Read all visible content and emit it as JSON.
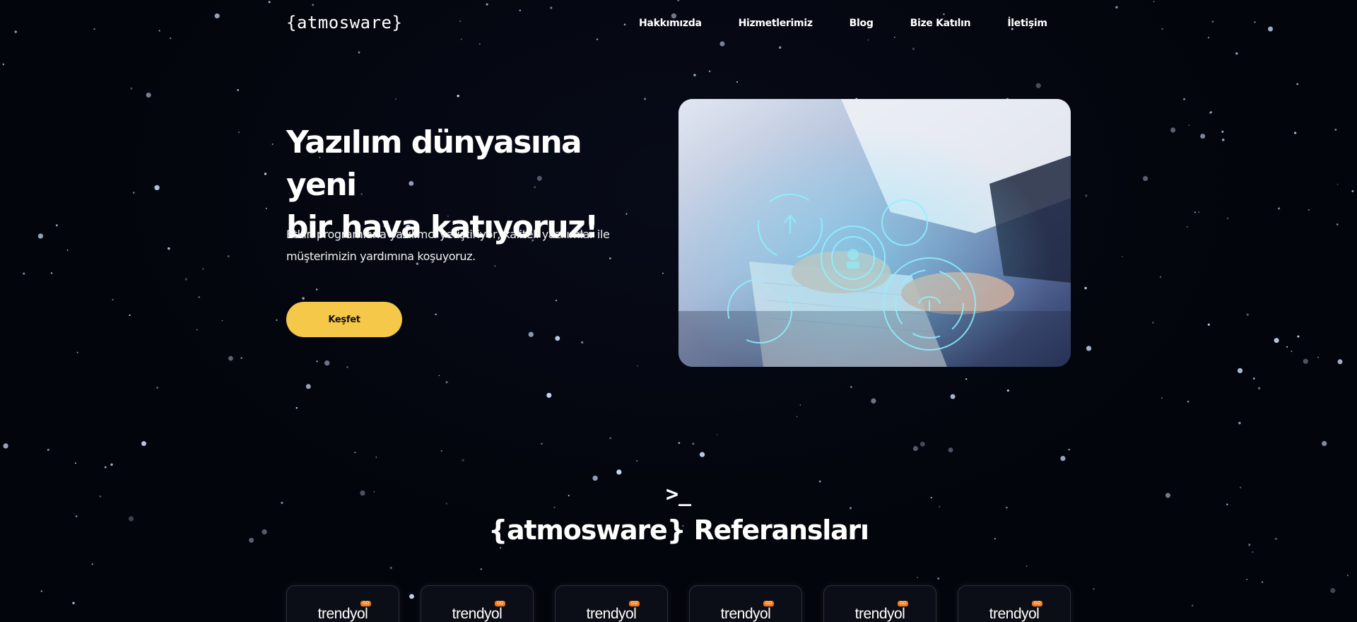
{
  "header": {
    "logo": "{atmosware}",
    "nav": [
      {
        "label": "Hakkımızda"
      },
      {
        "label": "Hizmetlerimiz"
      },
      {
        "label": "Blog"
      },
      {
        "label": "Bize Katılın"
      },
      {
        "label": "İletişim"
      }
    ]
  },
  "hero": {
    "title_line1": "Yazılım dünyasına yeni",
    "title_line2": "bir hava katıyoruz!",
    "subtitle_line1": "Etkin programlarla yazılımcı yetiştiriyor, kaliteli yazılımlar ile",
    "subtitle_line2": "müşterimizin yardımına koşuyoruz.",
    "cta_label": "Keşfet",
    "image_icon": "tech-hands-keyboard-image"
  },
  "references": {
    "prompt": ">_",
    "title": "{atmosware} Referansları",
    "items": [
      {
        "logo": "trendyol",
        "tag": "GO"
      },
      {
        "logo": "trendyol",
        "tag": "GO"
      },
      {
        "logo": "trendyol",
        "tag": "GO"
      },
      {
        "logo": "trendyol",
        "tag": "GO"
      },
      {
        "logo": "trendyol",
        "tag": "GO"
      },
      {
        "logo": "trendyol",
        "tag": "GO"
      }
    ]
  },
  "colors": {
    "background": "#03050c",
    "accent": "#f5c84a",
    "trendyol_orange": "#f27a1a"
  }
}
